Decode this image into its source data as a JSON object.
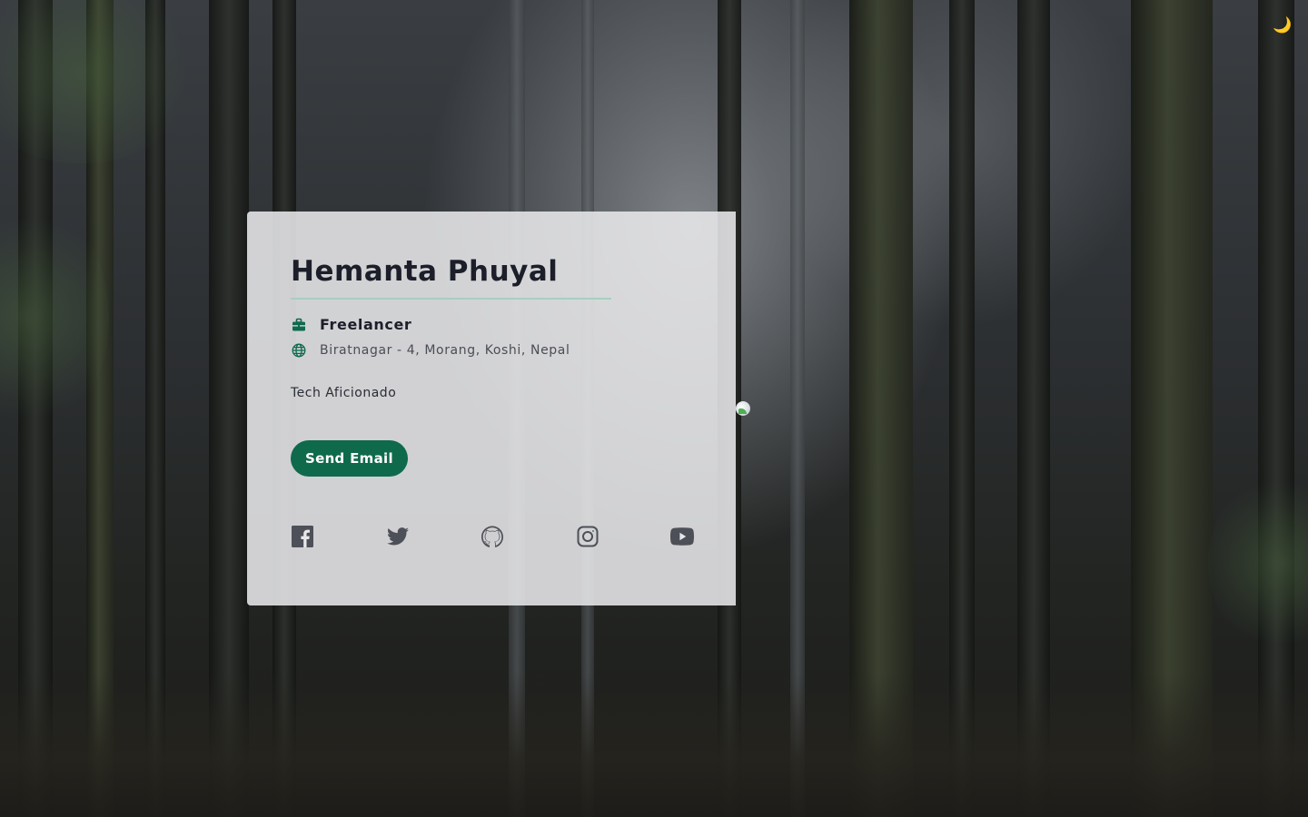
{
  "profile": {
    "name": "Hemanta Phuyal",
    "occupation": "Freelancer",
    "location": "Biratnagar - 4, Morang, Koshi, Nepal",
    "bio": "Tech Aficionado"
  },
  "actions": {
    "email_label": "Send Email"
  },
  "socials": [
    {
      "icon": "facebook-icon"
    },
    {
      "icon": "twitter-icon"
    },
    {
      "icon": "github-icon"
    },
    {
      "icon": "instagram-icon"
    },
    {
      "icon": "youtube-icon"
    }
  ],
  "theme_toggle": {
    "icon": "moon-icon",
    "glyph": "🌙"
  },
  "colors": {
    "accent": "#0f6a4c",
    "divider": "#a7cfbf",
    "card_bg": "#e8e8ea",
    "text_primary": "#1c1f2a"
  }
}
